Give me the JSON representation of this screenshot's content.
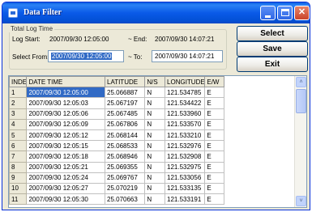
{
  "window": {
    "title": "Data Filter"
  },
  "titlebar_buttons": {
    "minimize": "",
    "maximize": "",
    "close": "✕"
  },
  "total_log_time": {
    "legend": "Total Log Time",
    "start_label": "Log Start:",
    "start_value": "2007/09/30 12:05:00",
    "end_sep": "~ End:",
    "end_value": "2007/09/30 14:07:21"
  },
  "select": {
    "from_label": "Select From:",
    "from_value": "2007/09/30 12:05:00",
    "to_sep": "~ To:",
    "to_value": "2007/09/30 14:07:21"
  },
  "buttons": {
    "select": "Select",
    "save": "Save",
    "exit": "Exit"
  },
  "table": {
    "columns": [
      "INDEX",
      "DATE TIME",
      "LATITUDE",
      "N/S",
      "LONGITUDE",
      "E/W"
    ],
    "rows": [
      [
        "1",
        "2007/09/30 12:05:00",
        "25.066887",
        "N",
        "121.534785",
        "E"
      ],
      [
        "2",
        "2007/09/30 12:05:03",
        "25.067197",
        "N",
        "121.534422",
        "E"
      ],
      [
        "3",
        "2007/09/30 12:05:06",
        "25.067485",
        "N",
        "121.533960",
        "E"
      ],
      [
        "4",
        "2007/09/30 12:05:09",
        "25.067806",
        "N",
        "121.533570",
        "E"
      ],
      [
        "5",
        "2007/09/30 12:05:12",
        "25.068144",
        "N",
        "121.533210",
        "E"
      ],
      [
        "6",
        "2007/09/30 12:05:15",
        "25.068533",
        "N",
        "121.532976",
        "E"
      ],
      [
        "7",
        "2007/09/30 12:05:18",
        "25.068946",
        "N",
        "121.532908",
        "E"
      ],
      [
        "8",
        "2007/09/30 12:05:21",
        "25.069355",
        "N",
        "121.532975",
        "E"
      ],
      [
        "9",
        "2007/09/30 12:05:24",
        "25.069767",
        "N",
        "121.533056",
        "E"
      ],
      [
        "10",
        "2007/09/30 12:05:27",
        "25.070219",
        "N",
        "121.533135",
        "E"
      ],
      [
        "11",
        "2007/09/30 12:05:30",
        "25.070663",
        "N",
        "121.533191",
        "E"
      ]
    ]
  },
  "scroll": {
    "up": "˄",
    "down": "˅"
  }
}
